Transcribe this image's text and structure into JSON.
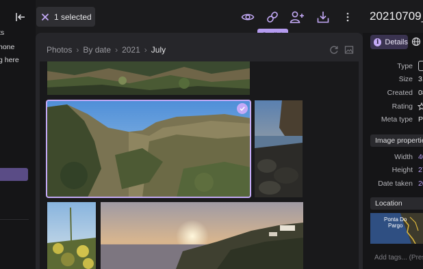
{
  "sidebar": {
    "collapse_icon": "collapse-left-icon",
    "items": [
      {
        "label": "ts"
      },
      {
        "label": "hone"
      },
      {
        "label": "g here"
      }
    ]
  },
  "toolbar": {
    "selection_label": "1 selected",
    "actions": [
      {
        "name": "view",
        "icon": "eye-icon"
      },
      {
        "name": "get-link",
        "icon": "link-icon"
      },
      {
        "name": "share",
        "icon": "person-add-icon"
      },
      {
        "name": "download",
        "icon": "download-icon"
      },
      {
        "name": "more",
        "icon": "more-vertical-icon"
      }
    ],
    "tooltip": "Get link"
  },
  "breadcrumb": [
    "Photos",
    "By date",
    "2021",
    "July"
  ],
  "breadcrumb_separator": "›",
  "file_title": "20210709_",
  "details": {
    "tabs": [
      {
        "label": "Details",
        "icon": "info-icon"
      },
      {
        "icon": "globe-icon"
      }
    ],
    "properties": [
      {
        "label": "Type",
        "value": ""
      },
      {
        "label": "Size",
        "value": "3."
      },
      {
        "label": "Created",
        "value": "08"
      },
      {
        "label": "Rating",
        "value": ""
      },
      {
        "label": "Meta type",
        "value": "Pl"
      }
    ],
    "image_properties_header": "Image properties",
    "image_properties": [
      {
        "label": "Width",
        "value": "40"
      },
      {
        "label": "Height",
        "value": "27"
      },
      {
        "label": "Date taken",
        "value": "20"
      }
    ],
    "location_header": "Location",
    "map_label_line1": "Ponta Do",
    "map_label_line2": "Pargo",
    "tags_placeholder": "Add tags... (Pres"
  },
  "colors": {
    "accent": "#c4aaf7",
    "background": "#1b1b1d",
    "card": "#26262a",
    "tooltip": "#b59cf0"
  }
}
